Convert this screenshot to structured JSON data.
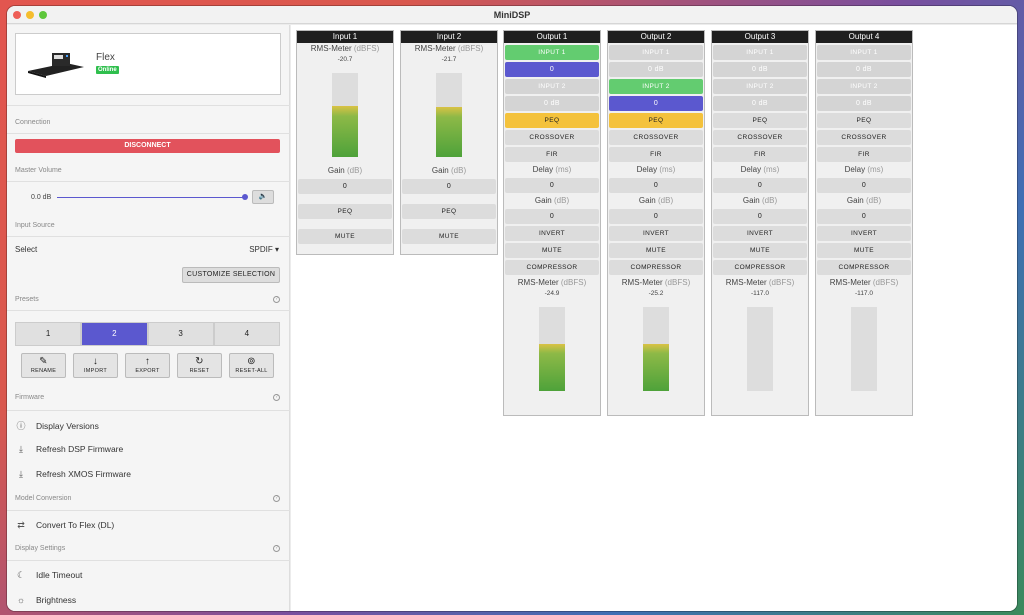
{
  "app": {
    "title": "MiniDSP"
  },
  "device": {
    "name": "Flex",
    "status": "Online"
  },
  "sidebar": {
    "connection_label": "Connection",
    "disconnect_label": "DISCONNECT",
    "master_volume_label": "Master Volume",
    "volume_value": "0.0 dB",
    "speaker_icon": "speaker-icon",
    "input_source_label": "Input Source",
    "select_label": "Select",
    "select_value": "SPDIF ▾",
    "customize_label": "CUSTOMIZE SELECTION",
    "presets_label": "Presets",
    "presets": [
      "1",
      "2",
      "3",
      "4"
    ],
    "active_preset": "2",
    "actions": [
      {
        "label": "RENAME",
        "icon": "✎"
      },
      {
        "label": "IMPORT",
        "icon": "↓"
      },
      {
        "label": "EXPORT",
        "icon": "↑"
      },
      {
        "label": "RESET",
        "icon": "↻"
      },
      {
        "label": "RESET-ALL",
        "icon": "⊚"
      }
    ],
    "firmware_label": "Firmware",
    "firmware_items": [
      {
        "label": "Display Versions",
        "icon": "ⓘ"
      },
      {
        "label": "Refresh DSP Firmware",
        "icon": "⤓"
      },
      {
        "label": "Refresh XMOS Firmware",
        "icon": "⤓"
      }
    ],
    "model_conversion_label": "Model Conversion",
    "convert_label": "Convert To Flex (DL)",
    "convert_icon": "⇄",
    "display_settings_label": "Display Settings",
    "display_items": [
      {
        "label": "Idle Timeout",
        "icon": "☾"
      },
      {
        "label": "Brightness",
        "icon": "☼"
      }
    ],
    "help": "?"
  },
  "inputs": [
    {
      "title": "Input 1",
      "meter_label": "RMS-Meter",
      "meter_unit": "(dBFS)",
      "meter_value": "-20.7",
      "level": 0.61,
      "gain_label": "Gain",
      "gain_unit": "(dB)",
      "gain": "0",
      "peq": "PEQ",
      "mute": "MUTE"
    },
    {
      "title": "Input 2",
      "meter_label": "RMS-Meter",
      "meter_unit": "(dBFS)",
      "meter_value": "-21.7",
      "level": 0.6,
      "gain_label": "Gain",
      "gain_unit": "(dB)",
      "gain": "0",
      "peq": "PEQ",
      "mute": "MUTE"
    }
  ],
  "outputs": [
    {
      "title": "Output 1",
      "in1": "INPUT 1",
      "in1_val": "0",
      "in2": "INPUT 2",
      "in2_val": "0 dB",
      "active": 1,
      "peq": "PEQ",
      "peq_on": true,
      "crossover": "CROSSOVER",
      "fir": "FIR",
      "delay_label": "Delay",
      "delay_unit": "(ms)",
      "delay": "0",
      "gain_label": "Gain",
      "gain_unit": "(dB)",
      "gain": "0",
      "invert": "INVERT",
      "mute": "MUTE",
      "compressor": "COMPRESSOR",
      "meter_label": "RMS-Meter",
      "meter_unit": "(dBFS)",
      "meter_value": "-24.9",
      "level": 0.56
    },
    {
      "title": "Output 2",
      "in1": "INPUT 1",
      "in1_val": "0 dB",
      "in2": "INPUT 2",
      "in2_val": "0",
      "active": 2,
      "peq": "PEQ",
      "peq_on": true,
      "crossover": "CROSSOVER",
      "fir": "FIR",
      "delay_label": "Delay",
      "delay_unit": "(ms)",
      "delay": "0",
      "gain_label": "Gain",
      "gain_unit": "(dB)",
      "gain": "0",
      "invert": "INVERT",
      "mute": "MUTE",
      "compressor": "COMPRESSOR",
      "meter_label": "RMS-Meter",
      "meter_unit": "(dBFS)",
      "meter_value": "-25.2",
      "level": 0.56
    },
    {
      "title": "Output 3",
      "in1": "INPUT 1",
      "in1_val": "0 dB",
      "in2": "INPUT 2",
      "in2_val": "0 dB",
      "active": 0,
      "peq": "PEQ",
      "peq_on": false,
      "crossover": "CROSSOVER",
      "fir": "FIR",
      "delay_label": "Delay",
      "delay_unit": "(ms)",
      "delay": "0",
      "gain_label": "Gain",
      "gain_unit": "(dB)",
      "gain": "0",
      "invert": "INVERT",
      "mute": "MUTE",
      "compressor": "COMPRESSOR",
      "meter_label": "RMS-Meter",
      "meter_unit": "(dBFS)",
      "meter_value": "-117.0",
      "level": 0
    },
    {
      "title": "Output 4",
      "in1": "INPUT 1",
      "in1_val": "0 dB",
      "in2": "INPUT 2",
      "in2_val": "0 dB",
      "active": 0,
      "peq": "PEQ",
      "peq_on": false,
      "crossover": "CROSSOVER",
      "fir": "FIR",
      "delay_label": "Delay",
      "delay_unit": "(ms)",
      "delay": "0",
      "gain_label": "Gain",
      "gain_unit": "(dB)",
      "gain": "0",
      "invert": "INVERT",
      "mute": "MUTE",
      "compressor": "COMPRESSOR",
      "meter_label": "RMS-Meter",
      "meter_unit": "(dBFS)",
      "meter_value": "-117.0",
      "level": 0
    }
  ],
  "colors": {
    "accent": "#5b58cf",
    "danger": "#e2525c",
    "online": "#2fbf4d",
    "active_input": "#63cc70",
    "peq_on": "#f4c23c"
  }
}
